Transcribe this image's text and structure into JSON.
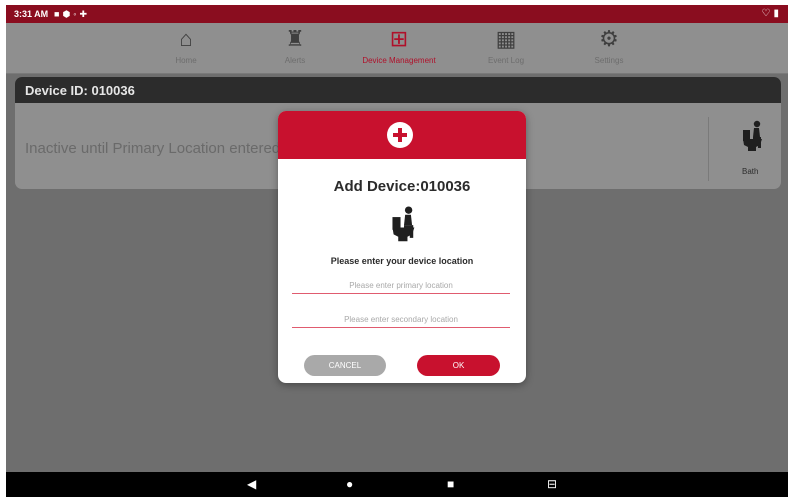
{
  "status_bar": {
    "time": "3:31 AM",
    "left_icons": [
      "notification-icon",
      "shield-icon",
      "wifi-icon",
      "app-icon"
    ],
    "right_icons": [
      "signal-icon",
      "battery-icon"
    ]
  },
  "nav": {
    "items": [
      {
        "label": "Home",
        "icon": "home-icon",
        "glyph": "⌂",
        "active": false
      },
      {
        "label": "Alerts",
        "icon": "alarm-icon",
        "glyph": "♜",
        "active": false
      },
      {
        "label": "Device Management",
        "icon": "monitor-plus-icon",
        "glyph": "⊞",
        "active": true
      },
      {
        "label": "Event Log",
        "icon": "calendar-icon",
        "glyph": "▦",
        "active": false
      },
      {
        "label": "Settings",
        "icon": "gear-icon",
        "glyph": "⚙",
        "active": false
      }
    ]
  },
  "device_card": {
    "header": "Device ID: 010036",
    "body_text": "Inactive until Primary Location entered",
    "location_label": "Bath",
    "location_icon": "toilet-person-icon"
  },
  "modal": {
    "header_icon": "plus-circle-icon",
    "title": "Add Device:010036",
    "icon": "toilet-person-icon",
    "prompt": "Please enter your device location",
    "primary_placeholder": "Please enter primary location",
    "primary_value": "",
    "secondary_placeholder": "Please enter secondary location",
    "secondary_value": "",
    "cancel_label": "CANCEL",
    "ok_label": "OK"
  },
  "android_nav": {
    "back_icon": "back-icon",
    "home_icon": "home-circle-icon",
    "recents_icon": "recents-icon",
    "extra_icon": "screen-icon"
  },
  "colors": {
    "brand_red": "#c8112e",
    "status_bar": "#8a0d1f",
    "overlay_gray": "#6e6e6e",
    "card_header": "#2c2c2c"
  }
}
